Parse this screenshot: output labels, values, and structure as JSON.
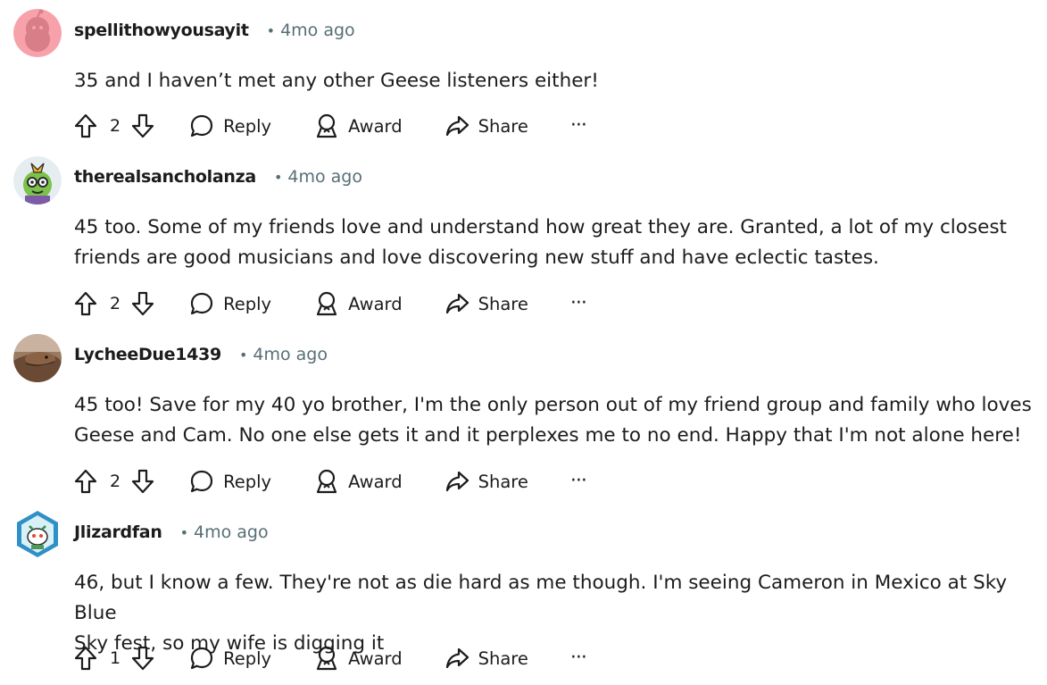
{
  "comments": [
    {
      "username": "spellithowyousayit",
      "dot": "•",
      "time": "4mo ago",
      "body_lines": [
        "35 and I haven’t met any other Geese listeners either!"
      ],
      "score": "2",
      "avatar": "pink-snoo-avatar"
    },
    {
      "username": "therealsancholanza",
      "dot": "•",
      "time": "4mo ago",
      "body_lines": [
        "45 too. Some of my friends love and understand how great they are. Granted, a lot of my closest",
        "friends are good musicians and love discovering new stuff and have eclectic tastes."
      ],
      "score": "2",
      "avatar": "green-creature-avatar"
    },
    {
      "username": "LycheeDue1439",
      "dot": "•",
      "time": "4mo ago",
      "body_lines": [
        "45 too! Save for my 40 yo brother, I'm the only person out of my friend group and family who loves",
        "Geese and Cam. No one else gets it and it perplexes me to no end. Happy that I'm not alone here!"
      ],
      "score": "2",
      "avatar": "lizard-photo-avatar"
    },
    {
      "username": "Jlizardfan",
      "dot": "•",
      "time": "4mo ago",
      "body_lines": [
        "46, but I know a few. They're not as die hard as me though. I'm seeing Cameron in Mexico at Sky Blue",
        "Sky fest, so my wife is digging it"
      ],
      "score": "1",
      "avatar": "snoo-hexagon-avatar"
    }
  ],
  "actions": {
    "reply": "Reply",
    "award": "Award",
    "share": "Share",
    "more": "···"
  },
  "icons": {
    "upvote": "upvote-arrow-icon",
    "downvote": "downvote-arrow-icon",
    "reply": "speech-bubble-icon",
    "award": "award-ribbon-icon",
    "share": "share-arrow-icon",
    "more": "ellipsis-icon"
  },
  "colors": {
    "text": "#1c1c1c",
    "meta": "#576f76",
    "background": "#ffffff"
  }
}
